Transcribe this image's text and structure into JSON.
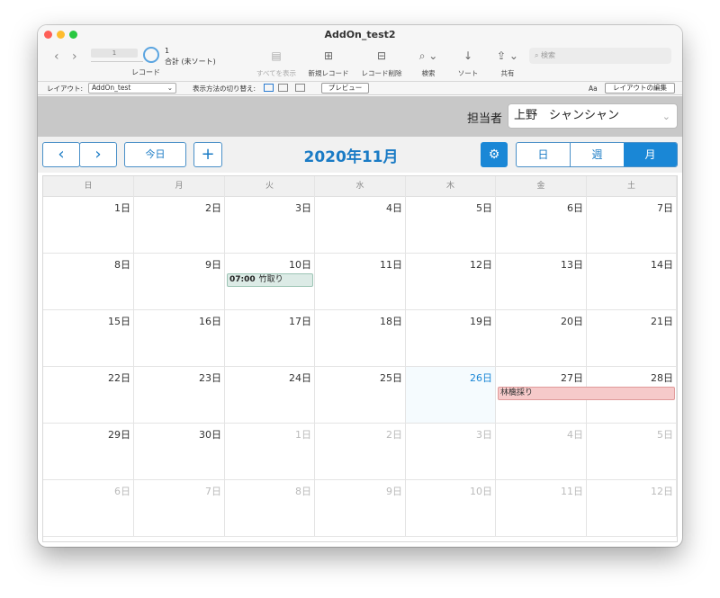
{
  "window": {
    "title": "AddOn_test2"
  },
  "toolbar": {
    "record_slider_value": "1",
    "record_label": "レコード",
    "record_count": "1",
    "record_sort_status": "合計 (未ソート)",
    "show_all": "すべてを表示",
    "new_record": "新規レコード",
    "delete_record": "レコード削除",
    "find": "検索",
    "sort": "ソート",
    "share": "共有",
    "search_placeholder": "検索"
  },
  "layout_bar": {
    "layout_label": "レイアウト:",
    "layout_value": "AddOn_test",
    "view_as_label": "表示方法の切り替え:",
    "preview": "プレビュー",
    "edit_layout": "レイアウトの編集",
    "font_glyph": "Aa"
  },
  "header": {
    "assignee_label": "担当者",
    "assignee_value": "上野　シャンシャン"
  },
  "calendar_bar": {
    "prev": "‹",
    "next": "›",
    "today": "今日",
    "add": "+",
    "month_title": "2020年11月",
    "gear": "⚙",
    "views": [
      "日",
      "週",
      "月"
    ],
    "active_view": "月"
  },
  "calendar": {
    "weekdays": [
      "日",
      "月",
      "火",
      "水",
      "木",
      "金",
      "土"
    ],
    "weeks": [
      [
        {
          "d": "1日",
          "o": false
        },
        {
          "d": "2日",
          "o": false
        },
        {
          "d": "3日",
          "o": false
        },
        {
          "d": "4日",
          "o": false
        },
        {
          "d": "5日",
          "o": false
        },
        {
          "d": "6日",
          "o": false
        },
        {
          "d": "7日",
          "o": false
        }
      ],
      [
        {
          "d": "8日",
          "o": false
        },
        {
          "d": "9日",
          "o": false
        },
        {
          "d": "10日",
          "o": false
        },
        {
          "d": "11日",
          "o": false
        },
        {
          "d": "12日",
          "o": false
        },
        {
          "d": "13日",
          "o": false
        },
        {
          "d": "14日",
          "o": false
        }
      ],
      [
        {
          "d": "15日",
          "o": false
        },
        {
          "d": "16日",
          "o": false
        },
        {
          "d": "17日",
          "o": false
        },
        {
          "d": "18日",
          "o": false
        },
        {
          "d": "19日",
          "o": false
        },
        {
          "d": "20日",
          "o": false
        },
        {
          "d": "21日",
          "o": false
        }
      ],
      [
        {
          "d": "22日",
          "o": false
        },
        {
          "d": "23日",
          "o": false
        },
        {
          "d": "24日",
          "o": false
        },
        {
          "d": "25日",
          "o": false
        },
        {
          "d": "26日",
          "o": false,
          "today": true
        },
        {
          "d": "27日",
          "o": false
        },
        {
          "d": "28日",
          "o": false
        }
      ],
      [
        {
          "d": "29日",
          "o": false
        },
        {
          "d": "30日",
          "o": false
        },
        {
          "d": "1日",
          "o": true
        },
        {
          "d": "2日",
          "o": true
        },
        {
          "d": "3日",
          "o": true
        },
        {
          "d": "4日",
          "o": true
        },
        {
          "d": "5日",
          "o": true
        }
      ],
      [
        {
          "d": "6日",
          "o": true
        },
        {
          "d": "7日",
          "o": true
        },
        {
          "d": "8日",
          "o": true
        },
        {
          "d": "9日",
          "o": true
        },
        {
          "d": "10日",
          "o": true
        },
        {
          "d": "11日",
          "o": true
        },
        {
          "d": "12日",
          "o": true
        }
      ]
    ],
    "events": [
      {
        "week": 1,
        "day": 2,
        "span": 1,
        "time": "07:00",
        "title": "竹取り",
        "color": "green"
      },
      {
        "week": 3,
        "day": 5,
        "span": 2,
        "time": "",
        "title": "林檎採り",
        "color": "red"
      }
    ]
  }
}
